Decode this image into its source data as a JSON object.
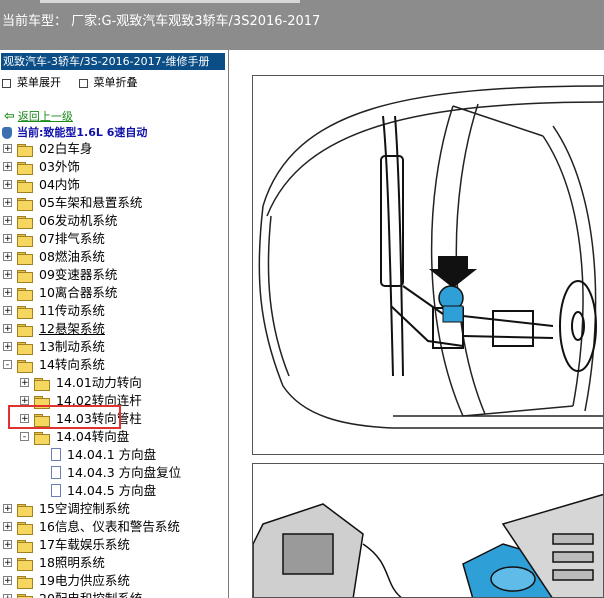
{
  "topbar": {
    "title": "当前车型： 厂家:G-观致汽车观致3轿车/3S2016-2017"
  },
  "manual": {
    "header": "观致汽车-3轿车/3S-2016-2017-维修手册",
    "expand_label": "菜单展开",
    "collapse_label": "菜单折叠",
    "back_label": "返回上一级",
    "current_label": "当前:致能型1.6L 6速自动"
  },
  "tree": [
    {
      "label": "02白车身",
      "level": 0,
      "type": "folder",
      "exp": "+"
    },
    {
      "label": "03外饰",
      "level": 0,
      "type": "folder",
      "exp": "+"
    },
    {
      "label": "04内饰",
      "level": 0,
      "type": "folder",
      "exp": "+"
    },
    {
      "label": "05车架和悬置系统",
      "level": 0,
      "type": "folder",
      "exp": "+"
    },
    {
      "label": "06发动机系统",
      "level": 0,
      "type": "folder",
      "exp": "+"
    },
    {
      "label": "07排气系统",
      "level": 0,
      "type": "folder",
      "exp": "+"
    },
    {
      "label": "08燃油系统",
      "level": 0,
      "type": "folder",
      "exp": "+"
    },
    {
      "label": "09变速器系统",
      "level": 0,
      "type": "folder",
      "exp": "+"
    },
    {
      "label": "10离合器系统",
      "level": 0,
      "type": "folder",
      "exp": "+"
    },
    {
      "label": "11传动系统",
      "level": 0,
      "type": "folder",
      "exp": "+"
    },
    {
      "label": "12悬架系统",
      "level": 0,
      "type": "folder",
      "exp": "+",
      "u": true
    },
    {
      "label": "13制动系统",
      "level": 0,
      "type": "folder",
      "exp": "+"
    },
    {
      "label": "14转向系统",
      "level": 0,
      "type": "folder",
      "exp": "-"
    },
    {
      "label": "14.01动力转向",
      "level": 1,
      "type": "folder",
      "exp": "+"
    },
    {
      "label": "14.02转向连杆",
      "level": 1,
      "type": "folder",
      "exp": "+"
    },
    {
      "label": "14.03转向管柱",
      "level": 1,
      "type": "folder",
      "exp": "+"
    },
    {
      "label": "14.04转向盘",
      "level": 1,
      "type": "folder",
      "exp": "-"
    },
    {
      "label": "14.04.1 方向盘",
      "level": 2,
      "type": "doc"
    },
    {
      "label": "14.04.3 方向盘复位",
      "level": 2,
      "type": "doc"
    },
    {
      "label": "14.04.5 方向盘",
      "level": 2,
      "type": "doc"
    },
    {
      "label": "15空调控制系统",
      "level": 0,
      "type": "folder",
      "exp": "+"
    },
    {
      "label": "16信息、仪表和警告系统",
      "level": 0,
      "type": "folder",
      "exp": "+"
    },
    {
      "label": "17车载娱乐系统",
      "level": 0,
      "type": "folder",
      "exp": "+"
    },
    {
      "label": "18照明系统",
      "level": 0,
      "type": "folder",
      "exp": "+"
    },
    {
      "label": "19电力供应系统",
      "level": 0,
      "type": "folder",
      "exp": "+"
    },
    {
      "label": "20配电和控制系统",
      "level": 0,
      "type": "folder",
      "exp": "+"
    }
  ],
  "colors": {
    "header_bg": "#0b4d86",
    "highlight": "#e0322f",
    "topbar": "#8c8c8c",
    "component_blue": "#2f9fd8"
  }
}
